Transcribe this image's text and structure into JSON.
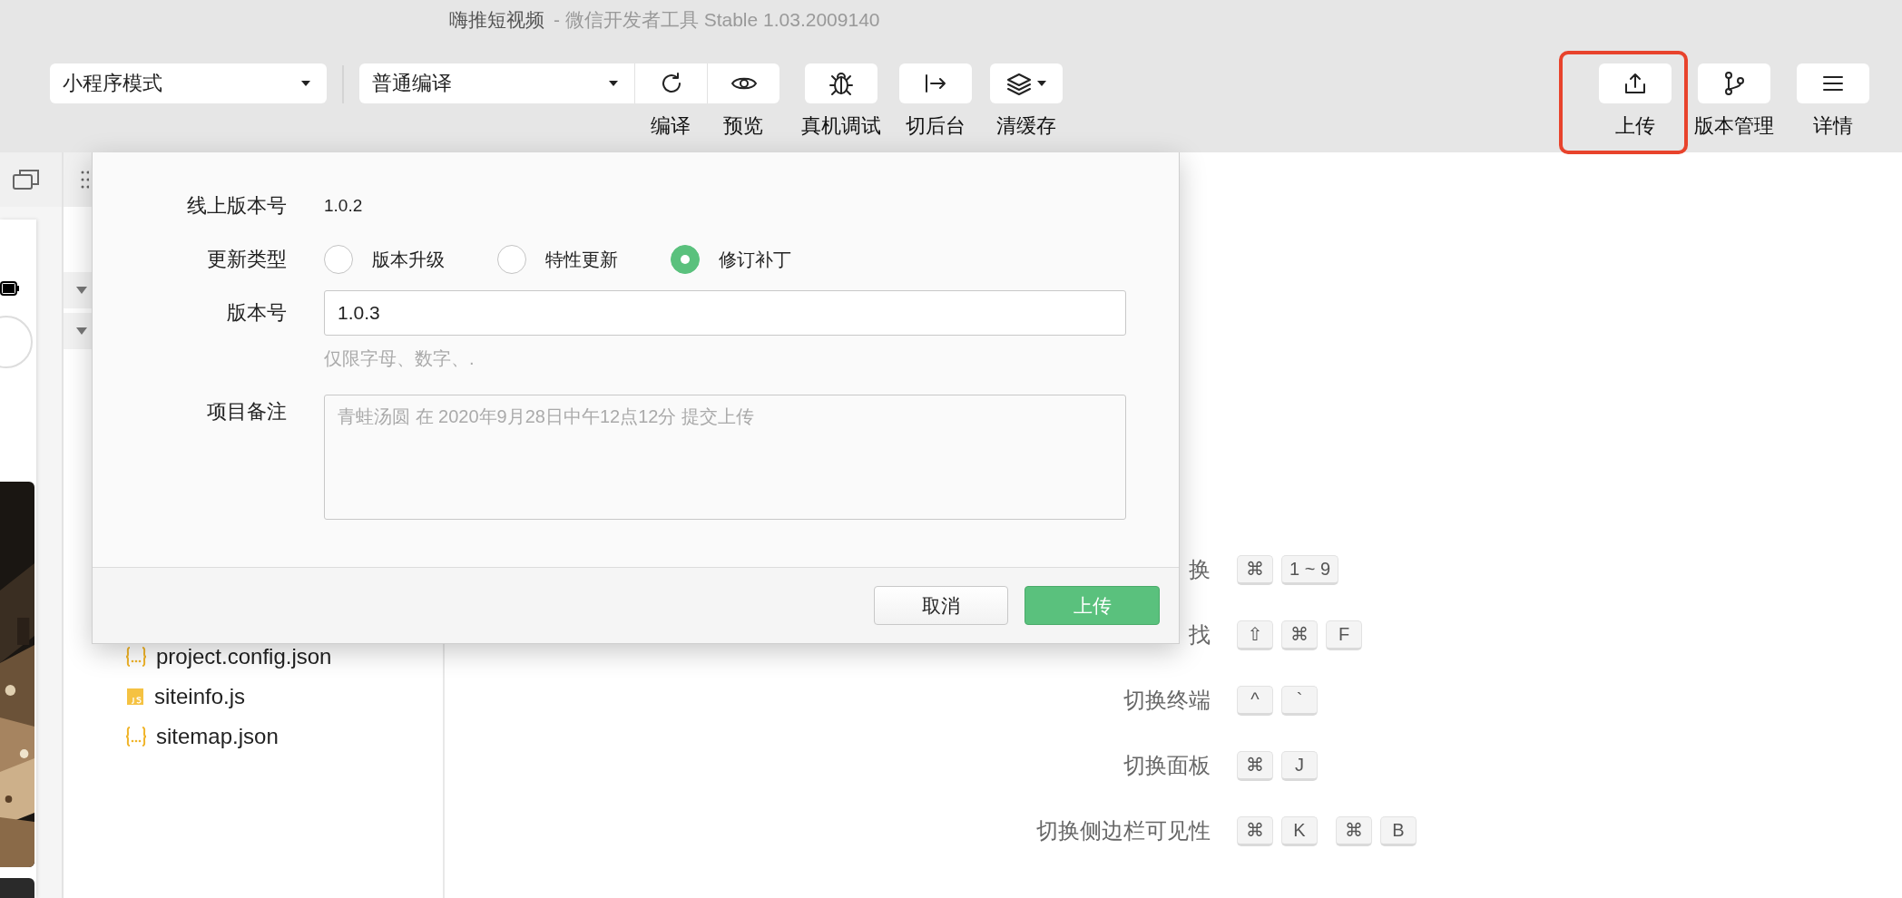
{
  "window": {
    "title": "嗨推短视频",
    "subtitle": "- 微信开发者工具 Stable 1.03.2009140"
  },
  "toolbar": {
    "mode_select": {
      "value": "小程序模式"
    },
    "compile_select": {
      "value": "普通编译"
    },
    "compile_tools": [
      {
        "label": "编译"
      },
      {
        "label": "预览"
      }
    ],
    "tools": [
      {
        "label": "真机调试",
        "dropdown": false
      },
      {
        "label": "切后台",
        "dropdown": false
      },
      {
        "label": "清缓存",
        "dropdown": true
      }
    ],
    "right_tools": [
      {
        "label": "上传",
        "highlighted": true
      },
      {
        "label": "版本管理",
        "highlighted": false
      },
      {
        "label": "详情",
        "highlighted": false
      }
    ]
  },
  "files": [
    {
      "name": "project.config.json",
      "kind": "json"
    },
    {
      "name": "siteinfo.js",
      "kind": "js"
    },
    {
      "name": "sitemap.json",
      "kind": "json"
    }
  ],
  "shortcuts": [
    {
      "label": "换",
      "keys": [
        [
          "⌘",
          "1 ~ 9"
        ]
      ]
    },
    {
      "label": "找",
      "keys": [
        [
          "⇧",
          "⌘",
          "F"
        ]
      ]
    },
    {
      "label": "切换终端",
      "keys": [
        [
          "^",
          "`"
        ]
      ]
    },
    {
      "label": "切换面板",
      "keys": [
        [
          "⌘",
          "J"
        ]
      ]
    },
    {
      "label": "切换侧边栏可见性",
      "keys": [
        [
          "⌘",
          "K"
        ],
        [
          "⌘",
          "B"
        ]
      ]
    }
  ],
  "dialog": {
    "online_version": {
      "label": "线上版本号",
      "value": "1.0.2"
    },
    "update_type": {
      "label": "更新类型",
      "options": [
        {
          "label": "版本升级",
          "selected": false
        },
        {
          "label": "特性更新",
          "selected": false
        },
        {
          "label": "修订补丁",
          "selected": true
        }
      ]
    },
    "version": {
      "label": "版本号",
      "value": "1.0.3",
      "hint": "仅限字母、数字、."
    },
    "notes": {
      "label": "项目备注",
      "placeholder": "青蛙汤圆 在 2020年9月28日中午12点12分 提交上传"
    },
    "buttons": [
      {
        "label": "取消",
        "kind": "secondary"
      },
      {
        "label": "上传",
        "kind": "primary"
      }
    ]
  }
}
